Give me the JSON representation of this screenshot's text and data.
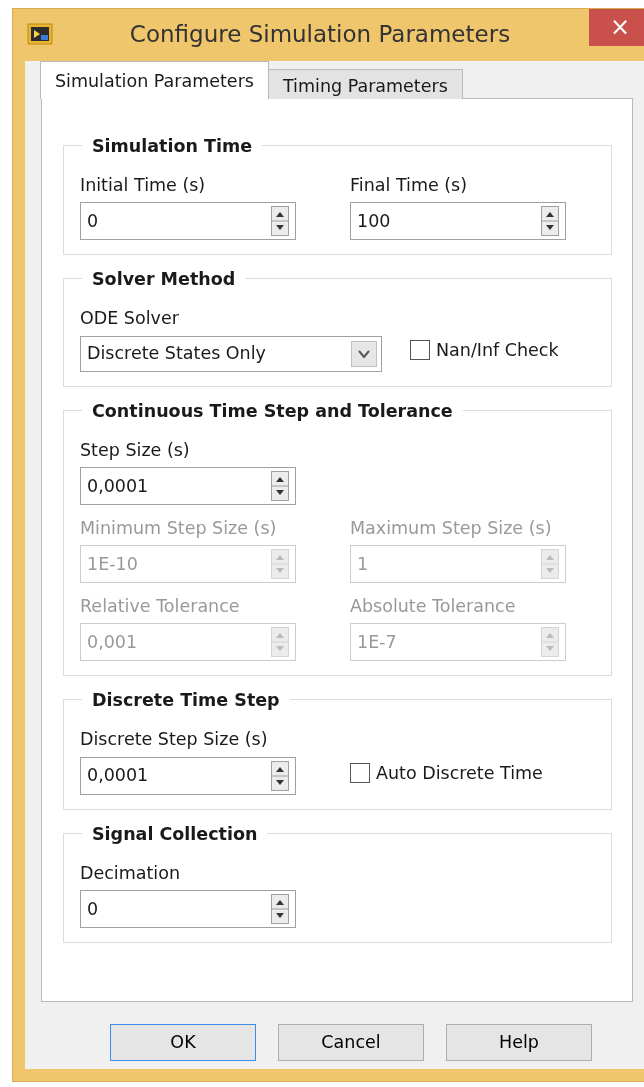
{
  "window": {
    "title": "Configure Simulation Parameters",
    "close": "×"
  },
  "tabs": [
    {
      "label": "Simulation Parameters",
      "selected": true
    },
    {
      "label": "Timing Parameters",
      "selected": false
    }
  ],
  "groups": [
    {
      "title": "Simulation Time",
      "rows": [
        [
          {
            "kind": "spin",
            "label": "Initial Time (s)",
            "value": "0",
            "disabled": false
          },
          {
            "kind": "spin",
            "label": "Final Time (s)",
            "value": "100",
            "disabled": false
          }
        ]
      ]
    },
    {
      "title": "Solver Method",
      "rows": [
        [
          {
            "kind": "dropdown",
            "label": "ODE Solver",
            "value": "Discrete States Only",
            "disabled": false
          },
          {
            "kind": "checkbox",
            "label": "Nan/Inf Check",
            "checked": false
          }
        ]
      ]
    },
    {
      "title": "Continuous Time Step and Tolerance",
      "rows": [
        [
          {
            "kind": "spin",
            "label": "Step Size (s)",
            "value": "0,0001",
            "disabled": false
          }
        ],
        [
          {
            "kind": "spin",
            "label": "Minimum Step Size (s)",
            "value": "1E-10",
            "disabled": true
          },
          {
            "kind": "spin",
            "label": "Maximum Step Size (s)",
            "value": "1",
            "disabled": true
          }
        ],
        [
          {
            "kind": "spin",
            "label": "Relative Tolerance",
            "value": "0,001",
            "disabled": true
          },
          {
            "kind": "spin",
            "label": "Absolute Tolerance",
            "value": "1E-7",
            "disabled": true
          }
        ]
      ]
    },
    {
      "title": "Discrete Time Step",
      "rows": [
        [
          {
            "kind": "spin",
            "label": "Discrete Step Size (s)",
            "value": "0,0001",
            "disabled": false
          },
          {
            "kind": "checkbox",
            "label": "Auto Discrete Time",
            "checked": false
          }
        ]
      ]
    },
    {
      "title": "Signal Collection",
      "rows": [
        [
          {
            "kind": "spin",
            "label": "Decimation",
            "value": "0",
            "disabled": false
          }
        ]
      ]
    }
  ],
  "buttons": [
    {
      "label": "OK",
      "default": true
    },
    {
      "label": "Cancel",
      "default": false
    },
    {
      "label": "Help",
      "default": false
    }
  ]
}
